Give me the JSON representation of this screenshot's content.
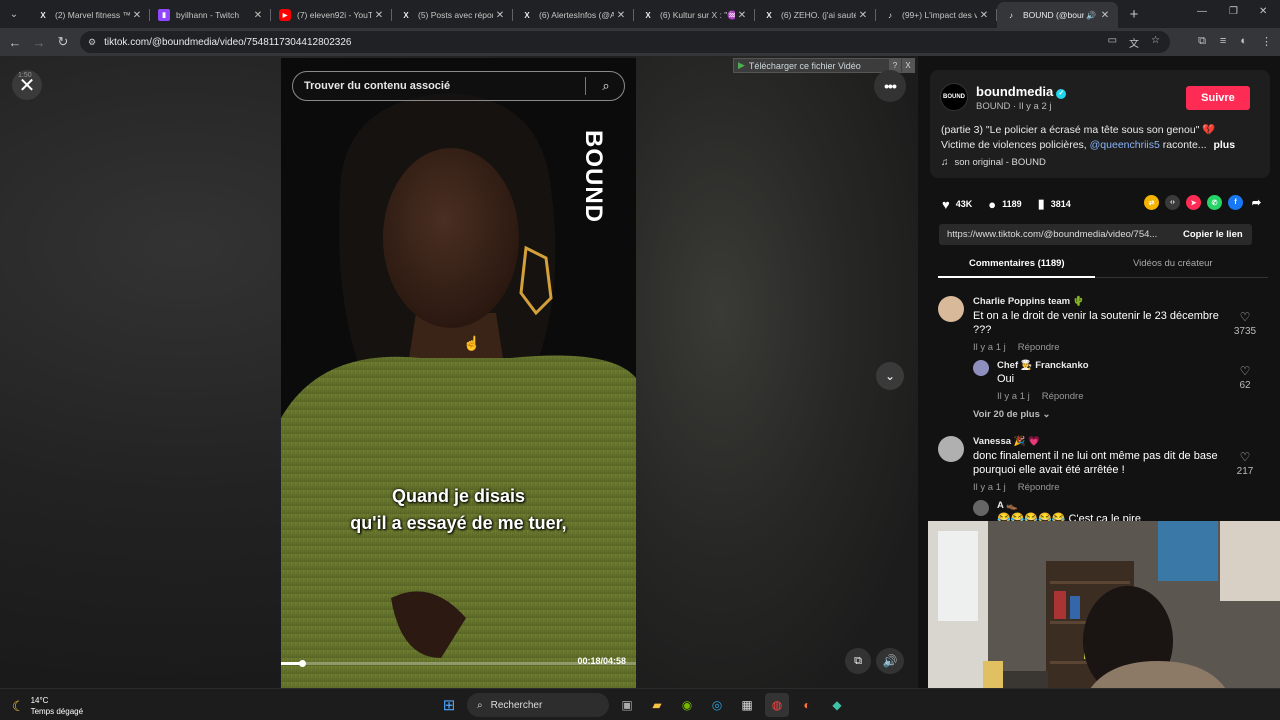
{
  "browser": {
    "tabs": [
      {
        "title": "(2) Marvel fitness ™ (",
        "favicon": "x-icon",
        "active": false
      },
      {
        "title": "byilhann - Twitch",
        "favicon": "twitch-icon",
        "active": false
      },
      {
        "title": "(7) eleven92i - YouTub",
        "favicon": "youtube-icon",
        "active": false
      },
      {
        "title": "(5) Posts avec répons",
        "favicon": "x-icon",
        "active": false
      },
      {
        "title": "(6) AlertesInfos (@Al",
        "favicon": "x-icon",
        "active": false
      },
      {
        "title": "(6) Kultur sur X : \"♒ ",
        "favicon": "x-icon",
        "active": false
      },
      {
        "title": "(6) ZEHO. (j'ai sauté)",
        "favicon": "x-icon",
        "active": false
      },
      {
        "title": "(99+) L'impact des vié",
        "favicon": "tiktok-icon",
        "active": false
      },
      {
        "title": "BOUND (@boun",
        "favicon": "tiktok-icon",
        "active": true
      }
    ],
    "url": "tiktok.com/@boundmedia/video/7548117304412802326"
  },
  "player": {
    "close_time": "1:50",
    "search_placeholder": "Trouver du contenu associé",
    "brand_watermark": "BOUND",
    "caption_line1": "Quand je disais",
    "caption_line2": "qu'il a essayé de me tuer,",
    "time_display": "00:18/04:58",
    "progress_fraction": 0.06,
    "download_label": "Télécharger ce fichier Vidéo",
    "download_q": "?",
    "download_x": "X"
  },
  "post": {
    "author": "boundmedia",
    "author_sub": "BOUND · Il y a 2 j",
    "avatar_text": "BOUND",
    "follow_label": "Suivre",
    "desc_part1": "(partie 3) \"Le policier a écrasé ma tête sous son genou\"",
    "desc_part2": "Victime de violences policières,",
    "desc_mention": "@queenchriis5",
    "desc_part3": "raconte...",
    "desc_more": "plus",
    "music": "son original - BOUND",
    "likes": "43K",
    "comments_count": "1189",
    "saves": "3814",
    "link": "https://www.tiktok.com/@boundmedia/video/754...",
    "copy_label": "Copier le lien",
    "tab_comments": "Commentaires (1189)",
    "tab_creator": "Vidéos du créateur"
  },
  "comments": [
    {
      "name": "Charlie Poppins team 🌵",
      "text": "Et on a le droit de venir la soutenir le 23 décembre ???",
      "meta": "Il y a 1 j",
      "reply": "Répondre",
      "likes": "3735"
    },
    {
      "name": "Chef 🧑‍🍳 Franckanko",
      "text": "Oui",
      "meta": "Il y a 1 j",
      "reply": "Répondre",
      "likes": "62"
    },
    {
      "name": "Vanessa 🎉 💗",
      "text": "donc finalement il ne lui ont même pas dit de base pourquoi elle avait été arrêtée !",
      "meta": "Il y a 1 j",
      "reply": "Répondre",
      "likes": "217"
    },
    {
      "name": "A 👞",
      "text": "😂😂😂😂😂 C'est ca le pire",
      "meta": "",
      "reply": "",
      "likes": ""
    }
  ],
  "see_more": "Voir 20 de plus ⌄",
  "taskbar": {
    "temp": "14°C",
    "weather": "Temps dégagé",
    "search": "Rechercher"
  }
}
